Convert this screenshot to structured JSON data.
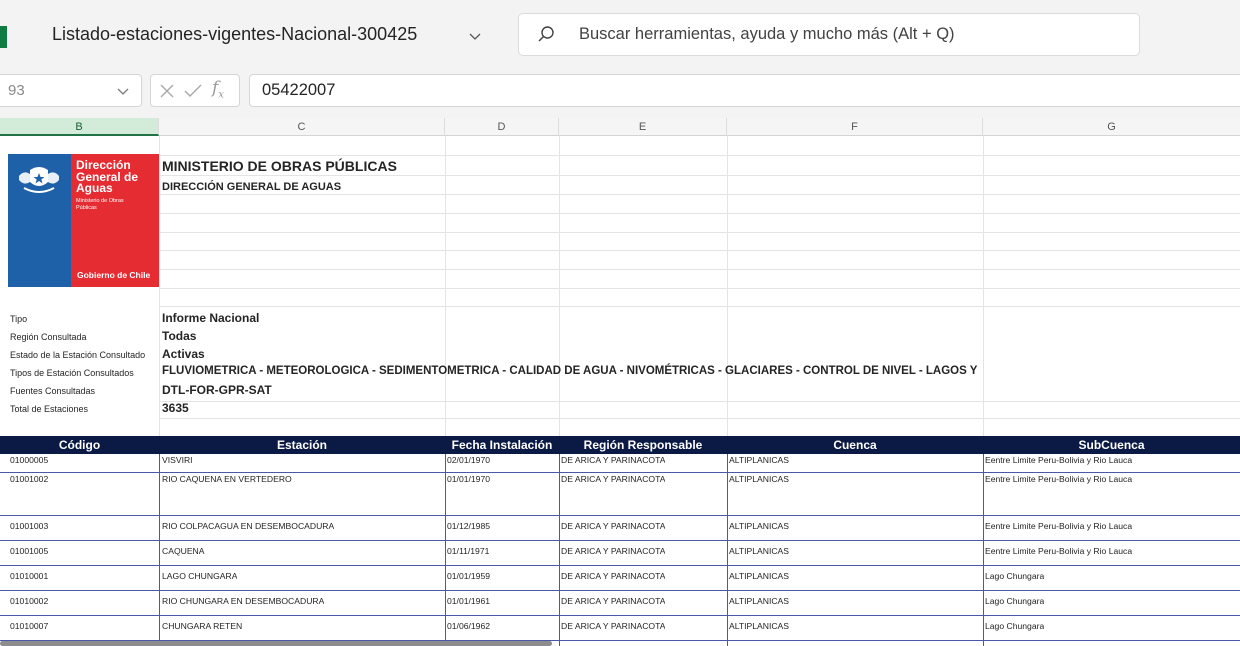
{
  "titlebar": {
    "doc_title": "Listado-estaciones-vigentes-Nacional-300425",
    "search_placeholder": "Buscar herramientas, ayuda y mucho más (Alt + Q)"
  },
  "formula_bar": {
    "namebox_value": "93",
    "fx_label": "f",
    "fx_sub": "x",
    "formula_value": "05422007"
  },
  "grid": {
    "columns": [
      "B",
      "C",
      "D",
      "E",
      "F",
      "G"
    ],
    "selected_column": "B"
  },
  "logo": {
    "title_lines": [
      "Dirección",
      "General de",
      "Aguas"
    ],
    "subtitle_lines": [
      "Ministerio de Obras",
      "Públicas"
    ],
    "footer": "Gobierno de Chile"
  },
  "report_header": {
    "ministry": "MINISTERIO DE OBRAS PÚBLICAS",
    "directorate": "DIRECCIÓN GENERAL DE AGUAS"
  },
  "info": [
    {
      "label": "Tipo",
      "value": "Informe Nacional"
    },
    {
      "label": "Región Consultada",
      "value": "Todas"
    },
    {
      "label": "Estado de la Estación Consultado",
      "value": "Activas"
    },
    {
      "label": "Tipos de Estación Consultados",
      "value": "FLUVIOMETRICA - METEOROLOGICA - SEDIMENTOMETRICA - CALIDAD DE AGUA - NIVOMÉTRICAS - GLACIARES - CONTROL DE NIVEL - LAGOS Y"
    },
    {
      "label": "Fuentes Consultadas",
      "value": "DTL-FOR-GPR-SAT"
    },
    {
      "label": "Total de Estaciones",
      "value": "3635"
    }
  ],
  "table": {
    "headers": [
      "Código",
      "Estación",
      "Fecha Instalación",
      "Región Responsable",
      "Cuenca",
      "SubCuenca"
    ],
    "rows": [
      [
        "01000005",
        "VISVIRI",
        "02/01/1970",
        "DE ARICA Y PARINACOTA",
        "ALTIPLANICAS",
        "Eentre Limite Peru-Bolivia y Rio Lauca"
      ],
      [
        "01001002",
        "RIO CAQUENA EN VERTEDERO",
        "01/01/1970",
        "DE ARICA Y PARINACOTA",
        "ALTIPLANICAS",
        "Eentre Limite Peru-Bolivia y Rio Lauca"
      ],
      [
        "01001003",
        "RIO COLPACAGUA EN DESEMBOCADURA",
        "01/12/1985",
        "DE ARICA Y PARINACOTA",
        "ALTIPLANICAS",
        "Eentre Limite Peru-Bolivia y Rio Lauca"
      ],
      [
        "01001005",
        "CAQUENA",
        "01/11/1971",
        "DE ARICA Y PARINACOTA",
        "ALTIPLANICAS",
        "Eentre Limite Peru-Bolivia y Rio Lauca"
      ],
      [
        "01010001",
        "LAGO CHUNGARA",
        "01/01/1959",
        "DE ARICA Y PARINACOTA",
        "ALTIPLANICAS",
        "Lago Chungara"
      ],
      [
        "01010002",
        "RIO CHUNGARA EN DESEMBOCADURA",
        "01/01/1961",
        "DE ARICA Y PARINACOTA",
        "ALTIPLANICAS",
        "Lago Chungara"
      ],
      [
        "01010007",
        "CHUNGARA RETEN",
        "01/06/1962",
        "DE ARICA Y PARINACOTA",
        "ALTIPLANICAS",
        "Lago Chungara"
      ]
    ]
  },
  "colors": {
    "chrome_bg": "#f3f3f3",
    "table_header_bg": "#0b1a44",
    "selected_col_bg": "#d3ecd9",
    "logo_blue": "#1f61a8",
    "logo_red": "#e52c32",
    "row_border": "#4a58a8"
  }
}
